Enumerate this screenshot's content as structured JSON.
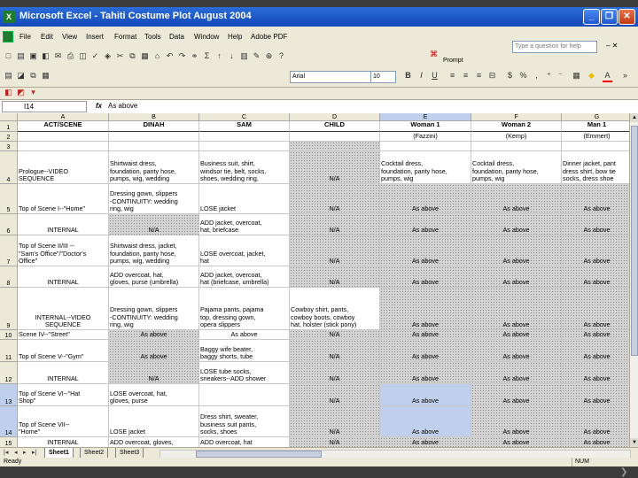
{
  "window": {
    "title": "Microsoft Excel - Tahiti Costume Plot August 2004",
    "app_icon": "X"
  },
  "menu": [
    "File",
    "Edit",
    "View",
    "Insert",
    "Format",
    "Tools",
    "Data",
    "Window",
    "Help",
    "Adobe PDF"
  ],
  "help_placeholder": "Type a question for help",
  "prompt_label": "Prompt",
  "font_name": "Arial",
  "font_size": "10",
  "name_box": "I14",
  "formula_value": "As above",
  "fx_label": "fx",
  "columns": [
    {
      "letter": "A",
      "w": 103
    },
    {
      "letter": "B",
      "w": 102
    },
    {
      "letter": "C",
      "w": 102
    },
    {
      "letter": "D",
      "w": 102
    },
    {
      "letter": "E",
      "w": 103,
      "selected": true
    },
    {
      "letter": "F",
      "w": 102
    },
    {
      "letter": "G",
      "w": 80
    }
  ],
  "rows": [
    {
      "num": "1",
      "h": 12,
      "cells": [
        {
          "t": "ACT/SCENE",
          "s": "hdr"
        },
        {
          "t": "DINAH",
          "s": "hdr"
        },
        {
          "t": "SAM",
          "s": "hdr"
        },
        {
          "t": "CHILD",
          "s": "hdr"
        },
        {
          "t": "Woman 1",
          "s": "hdr"
        },
        {
          "t": "Woman 2",
          "s": "hdr"
        },
        {
          "t": "Man 1",
          "s": "hdr"
        }
      ]
    },
    {
      "num": "2",
      "h": 11,
      "cells": [
        {
          "t": ""
        },
        {
          "t": ""
        },
        {
          "t": ""
        },
        {
          "t": ""
        },
        {
          "t": "(Fazzini)",
          "s": "ac"
        },
        {
          "t": "(Kemp)",
          "s": "ac"
        },
        {
          "t": "(Emmert)",
          "s": "ac"
        }
      ]
    },
    {
      "num": "3",
      "h": 11,
      "cells": [
        {
          "t": ""
        },
        {
          "t": ""
        },
        {
          "t": ""
        },
        {
          "t": "",
          "g": true
        },
        {
          "t": ""
        },
        {
          "t": ""
        },
        {
          "t": ""
        }
      ]
    },
    {
      "num": "4",
      "h": 37,
      "cells": [
        {
          "t": "Prologue--VIDEO\nSEQUENCE",
          "s": "al"
        },
        {
          "t": "Shirtwaist dress,\nfoundation, panty hose,\npumps, wig, wedding",
          "s": "al"
        },
        {
          "t": "Business suit, shirt,\nwindsor tie, belt, socks,\nshoes, wedding ring,",
          "s": "al"
        },
        {
          "t": "N/A",
          "s": "ac",
          "g": true
        },
        {
          "t": "Cocktail dress,\nfoundation, panty hose,\npumps, wig",
          "s": "al"
        },
        {
          "t": "Cocktail dress,\nfoundation, panty hose,\npumps, wig",
          "s": "al"
        },
        {
          "t": "Dinner jacket, pant\ndress shirt, bow tie\nsocks, dress shoe",
          "s": "al"
        }
      ]
    },
    {
      "num": "5",
      "h": 34,
      "cells": [
        {
          "t": "Top of Scene I--\"Home\"",
          "s": "al"
        },
        {
          "t": "Dressing gown, slippers\n-CONTINUITY: wedding\nring, wig",
          "s": "al"
        },
        {
          "t": "LOSE jacket",
          "s": "al"
        },
        {
          "t": "N/A",
          "s": "ac",
          "g": true
        },
        {
          "t": "As above",
          "s": "ac",
          "g": true
        },
        {
          "t": "As above",
          "s": "ac",
          "g": true
        },
        {
          "t": "As above",
          "s": "ac",
          "g": true
        }
      ]
    },
    {
      "num": "6",
      "h": 24,
      "cells": [
        {
          "t": "INTERNAL",
          "s": "ac"
        },
        {
          "t": "N/A",
          "s": "ac",
          "g": true
        },
        {
          "t": "ADD jacket, overcoat,\nhat, briefcase",
          "s": "al"
        },
        {
          "t": "N/A",
          "s": "ac",
          "g": true
        },
        {
          "t": "As above",
          "s": "ac",
          "g": true
        },
        {
          "t": "As above",
          "s": "ac",
          "g": true
        },
        {
          "t": "As above",
          "s": "ac",
          "g": true
        }
      ]
    },
    {
      "num": "7",
      "h": 35,
      "cells": [
        {
          "t": "Top of Scene II/III --\n\"Sam's Office\"/\"Doctor's\nOffice\"",
          "s": "al"
        },
        {
          "t": "Shirtwaist dress, jacket,\nfoundation, panty hose,\npumps, wig, wedding",
          "s": "al"
        },
        {
          "t": "LOSE overcoat, jacket,\nhat",
          "s": "al"
        },
        {
          "t": "N/A",
          "s": "ac",
          "g": true
        },
        {
          "t": "As above",
          "s": "ac",
          "g": true
        },
        {
          "t": "As above",
          "s": "ac",
          "g": true
        },
        {
          "t": "As above",
          "s": "ac",
          "g": true
        }
      ]
    },
    {
      "num": "8",
      "h": 24,
      "cells": [
        {
          "t": "INTERNAL",
          "s": "ac"
        },
        {
          "t": "ADD overcoat, hat,\ngloves, purse (umbrella)",
          "s": "al"
        },
        {
          "t": "ADD jacket, overcoat,\nhat (briefcase, umbrella)",
          "s": "al"
        },
        {
          "t": "N/A",
          "s": "ac",
          "g": true
        },
        {
          "t": "As above",
          "s": "ac",
          "g": true
        },
        {
          "t": "As above",
          "s": "ac",
          "g": true
        },
        {
          "t": "As above",
          "s": "ac",
          "g": true
        }
      ]
    },
    {
      "num": "9",
      "h": 48,
      "cells": [
        {
          "t": "INTERNAL--VIDEO\nSEQUENCE",
          "s": "ac"
        },
        {
          "t": "Dressing gown, slippers\n-CONTINUITY: wedding\nring, wig",
          "s": "al"
        },
        {
          "t": "Pajama pants, pajama\ntop, dressing gown,\nopera slippers",
          "s": "al"
        },
        {
          "t": "Cowboy shirt, pants,\ncowboy boots, cowboy\nhat, holster (stick pony)",
          "s": "al"
        },
        {
          "t": "As above",
          "s": "ac",
          "g": true
        },
        {
          "t": "As above",
          "s": "ac",
          "g": true
        },
        {
          "t": "As above",
          "s": "ac",
          "g": true
        }
      ]
    },
    {
      "num": "10",
      "h": 11,
      "cells": [
        {
          "t": "Scene IV--\"Street\"",
          "s": "al"
        },
        {
          "t": "As above",
          "s": "ac",
          "g": true
        },
        {
          "t": "As above",
          "s": "ac"
        },
        {
          "t": "N/A",
          "s": "ac",
          "g": true
        },
        {
          "t": "As above",
          "s": "ac",
          "g": true
        },
        {
          "t": "As above",
          "s": "ac",
          "g": true
        },
        {
          "t": "As above",
          "s": "ac",
          "g": true
        }
      ]
    },
    {
      "num": "11",
      "h": 25,
      "cells": [
        {
          "t": "Top of Scene V--\"Gym\"",
          "s": "al"
        },
        {
          "t": "As above",
          "s": "ac",
          "g": true
        },
        {
          "t": "Baggy wife beater,\nbaggy shorts, tube",
          "s": "al"
        },
        {
          "t": "N/A",
          "s": "ac",
          "g": true
        },
        {
          "t": "As above",
          "s": "ac",
          "g": true
        },
        {
          "t": "As above",
          "s": "ac",
          "g": true
        },
        {
          "t": "As above",
          "s": "ac",
          "g": true
        }
      ]
    },
    {
      "num": "12",
      "h": 25,
      "cells": [
        {
          "t": "INTERNAL",
          "s": "ac"
        },
        {
          "t": "N/A",
          "s": "ac",
          "g": true
        },
        {
          "t": "LOSE tube socks,\nsneakers--ADD shower",
          "s": "al"
        },
        {
          "t": "N/A",
          "s": "ac",
          "g": true
        },
        {
          "t": "As above",
          "s": "ac",
          "g": true
        },
        {
          "t": "As above",
          "s": "ac",
          "g": true
        },
        {
          "t": "As above",
          "s": "ac",
          "g": true
        }
      ]
    },
    {
      "num": "13",
      "h": 25,
      "sel": true,
      "cells": [
        {
          "t": "Top of Scene VI--\"Hat\nShop\"",
          "s": "al"
        },
        {
          "t": "LOSE overcoat, hat,\ngloves, purse",
          "s": "al"
        },
        {
          "t": "",
          "s": "al"
        },
        {
          "t": "N/A",
          "s": "ac",
          "g": true
        },
        {
          "t": "As above",
          "s": "ac",
          "b": true
        },
        {
          "t": "As above",
          "s": "ac",
          "g": true
        },
        {
          "t": "As above",
          "s": "ac",
          "g": true
        }
      ]
    },
    {
      "num": "14",
      "h": 35,
      "sel": true,
      "cells": [
        {
          "t": "Top of Scene VII--\n\"Home\"",
          "s": "al"
        },
        {
          "t": "LOSE jacket",
          "s": "al"
        },
        {
          "t": "Dress shirt, sweater,\nbusiness suit pants,\nsocks, shoes",
          "s": "al"
        },
        {
          "t": "N/A",
          "s": "ac",
          "g": true
        },
        {
          "t": "As above",
          "s": "ac",
          "b": true
        },
        {
          "t": "As above",
          "s": "ac",
          "g": true
        },
        {
          "t": "As above",
          "s": "ac",
          "g": true
        }
      ]
    },
    {
      "num": "15",
      "h": 12,
      "cells": [
        {
          "t": "INTERNAL",
          "s": "ac"
        },
        {
          "t": "ADD overcoat, gloves,",
          "s": "al"
        },
        {
          "t": "ADD overcoat, hat",
          "s": "al"
        },
        {
          "t": "N/A",
          "s": "ac",
          "g": true
        },
        {
          "t": "As above",
          "s": "ac",
          "g": true
        },
        {
          "t": "As above",
          "s": "ac",
          "g": true
        },
        {
          "t": "As above",
          "s": "ac",
          "g": true
        }
      ]
    },
    {
      "num": "16",
      "h": 12,
      "cells": [
        {
          "t": ""
        },
        {
          "t": ""
        },
        {
          "t": ""
        },
        {
          "t": "N/A",
          "s": "ac",
          "g": true
        },
        {
          "t": ""
        },
        {
          "t": ""
        },
        {
          "t": ""
        }
      ]
    }
  ],
  "sheets": [
    "Sheet1",
    "Sheet2",
    "Sheet3"
  ],
  "active_sheet": "Sheet1",
  "status": "Ready",
  "status_num": "NUM"
}
